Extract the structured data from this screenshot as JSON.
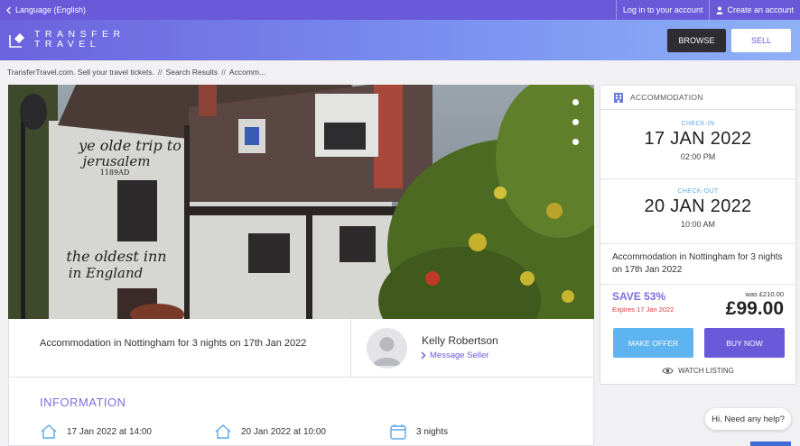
{
  "topbar": {
    "language": "Language (English)",
    "login": "Log in to your account",
    "create": "Create an account"
  },
  "header": {
    "logo_line1": "TRANSFER",
    "logo_line2": "TRAVEL",
    "browse": "BROWSE",
    "sell": "SELL"
  },
  "breadcrumb": {
    "home": "TransferTravel.com. Sell your travel tickets.",
    "sep": "//",
    "results": "Search Results",
    "current": "Accomm..."
  },
  "listing": {
    "title": "Accommodation in Nottingham for 3 nights on 17th Jan 2022",
    "seller_name": "Kelly Robertson",
    "message_seller": "Message Seller",
    "info_heading": "INFORMATION",
    "checkin_info": "17 Jan 2022 at 14:00",
    "checkout_info": "20 Jan 2022 at 10:00",
    "nights": "3 nights"
  },
  "photo": {
    "sign_line1": "ye olde trip to",
    "sign_line2": "jerusalem",
    "sign_year": "1189AD",
    "sign_line3": "the oldest inn",
    "sign_line4": "in England"
  },
  "card": {
    "heading": "ACCOMMODATION",
    "checkin_label": "CHECK-IN",
    "checkin_date": "17 JAN 2022",
    "checkin_time": "02:00 PM",
    "checkout_label": "CHECK-OUT",
    "checkout_date": "20 JAN 2022",
    "checkout_time": "10:00 AM",
    "description": "Accommodation in Nottingham for 3 nights on 17th Jan 2022",
    "save": "SAVE 53%",
    "expires": "Expires 17 Jan 2022",
    "was": "was £210.00",
    "price": "£99.00",
    "make_offer": "MAKE OFFER",
    "buy_now": "BUY NOW",
    "watch": "WATCH LISTING"
  },
  "chat": {
    "text": "Hi. Need any help?"
  },
  "colors": {
    "brand": "#6a5ad9",
    "accent_blue": "#5db4f1",
    "dark": "#2d2d33",
    "expire_red": "#e23a3a"
  }
}
